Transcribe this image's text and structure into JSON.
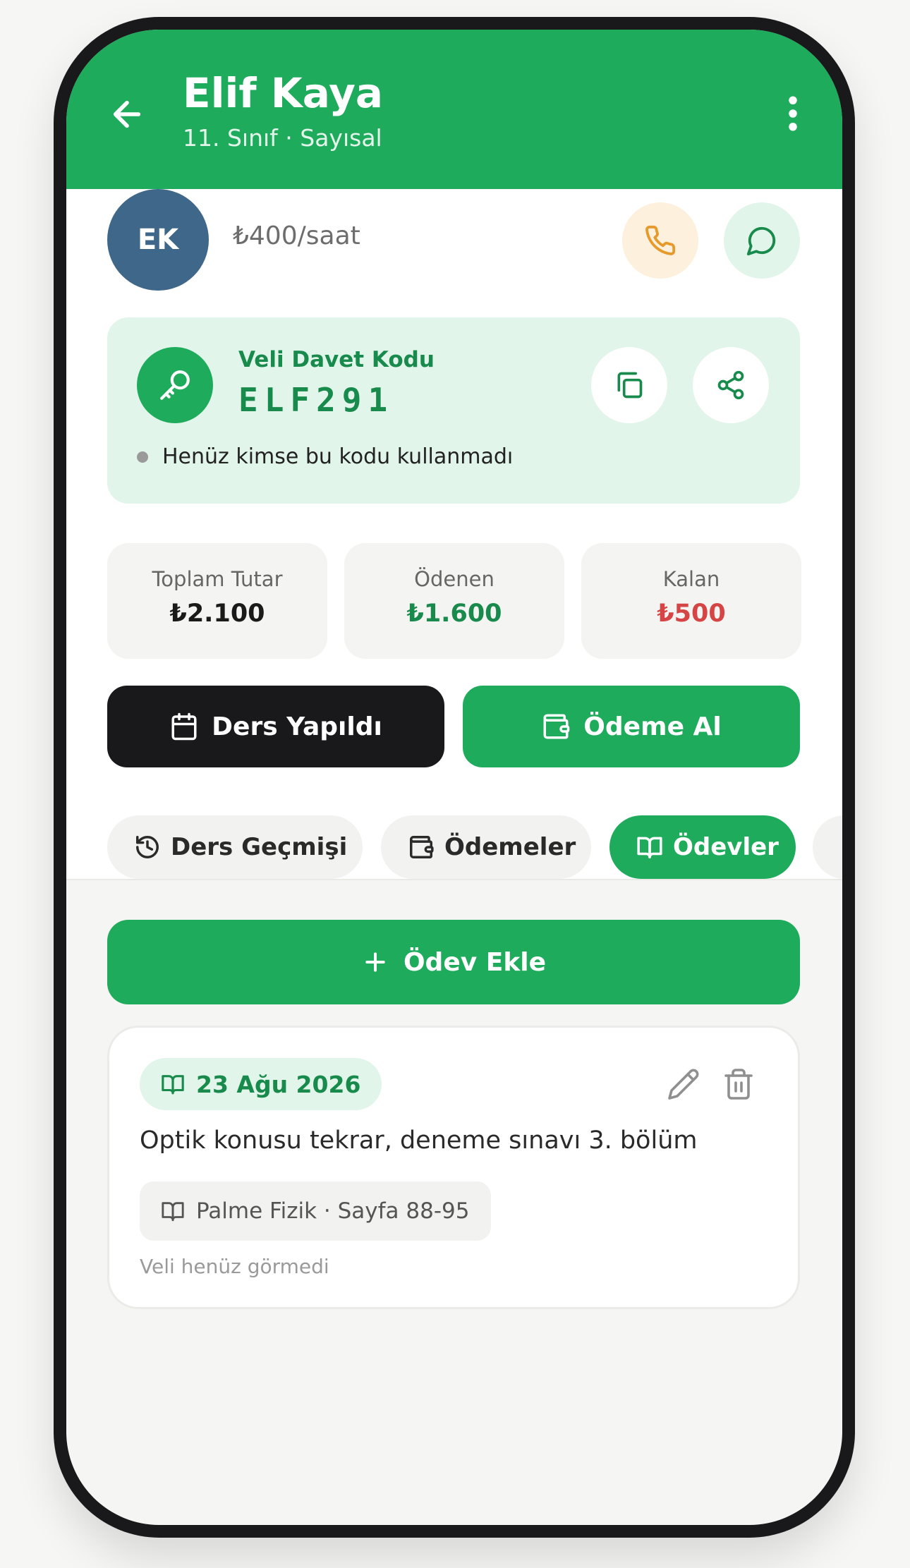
{
  "header": {
    "title": "Elif Kaya",
    "subtitle": "11. Sınıf · Sayısal"
  },
  "profile": {
    "initials": "EK",
    "rate": "₺400/saat"
  },
  "invite": {
    "label": "Veli Davet Kodu",
    "code": "ELF291",
    "status": "Henüz kimse bu kodu kullanmadı"
  },
  "stats": [
    {
      "label": "Toplam Tutar",
      "value": "₺2.100",
      "color": "#1a1a1a"
    },
    {
      "label": "Ödenen",
      "value": "₺1.600",
      "color": "#188a4b"
    },
    {
      "label": "Kalan",
      "value": "₺500",
      "color": "#d64545"
    }
  ],
  "actions": {
    "lesson_done": "Ders Yapıldı",
    "take_payment": "Ödeme Al"
  },
  "tabs": [
    {
      "label": "Ders Geçmişi",
      "icon": "history-icon"
    },
    {
      "label": "Ödemeler",
      "icon": "wallet-icon"
    },
    {
      "label": "Ödevler",
      "icon": "book-icon"
    }
  ],
  "add_homework": "Ödev Ekle",
  "homework": {
    "date": "23 Ağu 2026",
    "text": "Optik konusu tekrar, deneme sınavı 3. bölüm",
    "source": "Palme Fizik · Sayfa 88-95",
    "seen_status": "Veli henüz görmedi"
  },
  "colors": {
    "accent": "#1eab5c",
    "accent_dark": "#188a4b",
    "accent_light": "#e2f5ea",
    "dark": "#19191b"
  }
}
